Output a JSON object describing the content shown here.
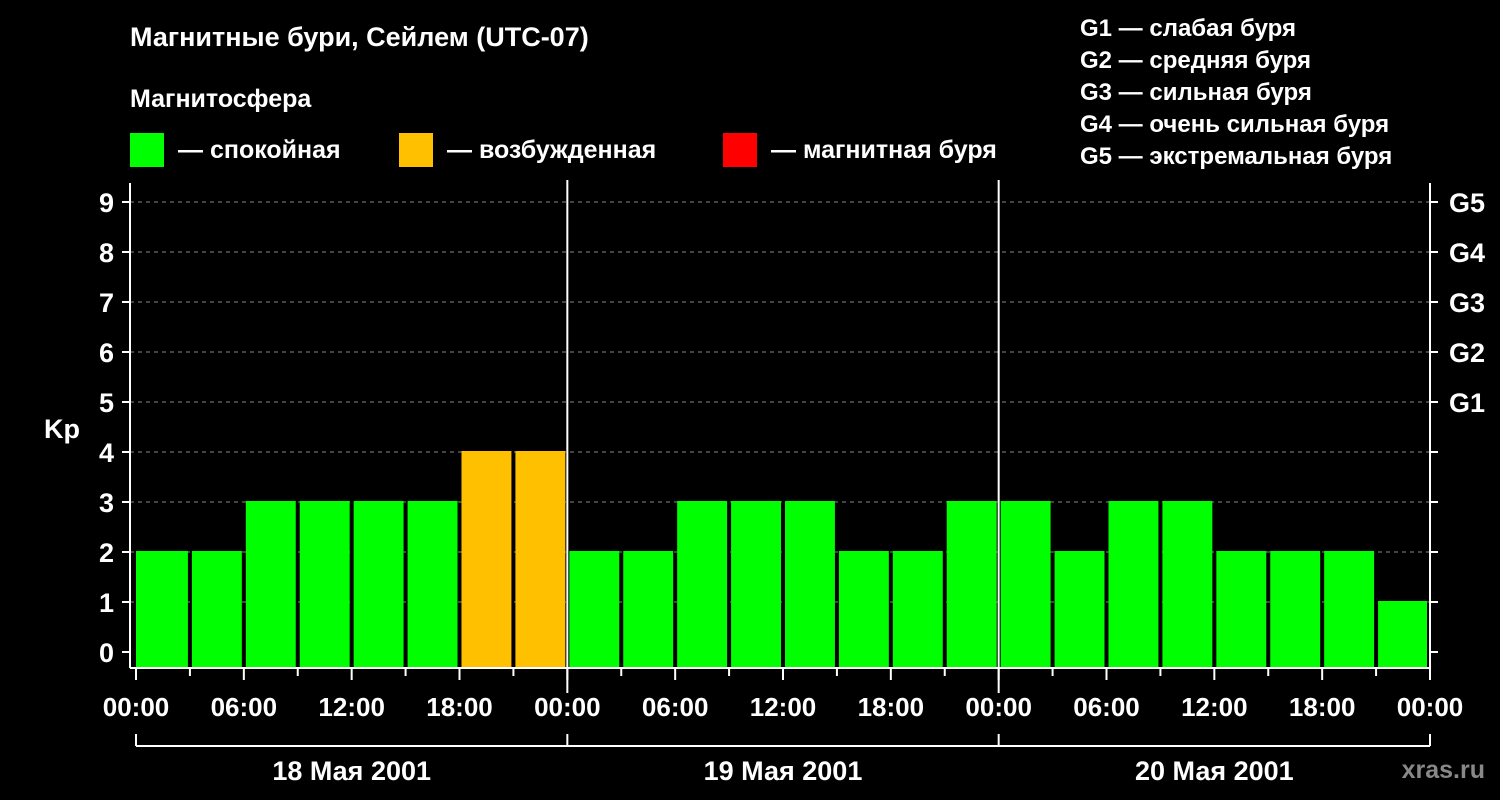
{
  "title": "Магнитные бури, Сейлем (UTC-07)",
  "subtitle": "Магнитосфера",
  "legend": [
    {
      "label": "— спокойная",
      "color": "#00ff00"
    },
    {
      "label": "— возбужденная",
      "color": "#ffc000"
    },
    {
      "label": "— магнитная буря",
      "color": "#ff0000"
    }
  ],
  "g_scale": [
    "G1 — слабая буря",
    "G2 — средняя буря",
    "G3 — сильная буря",
    "G4 — очень сильная буря",
    "G5 — экстремальная буря"
  ],
  "watermark": "xras.ru",
  "chart_data": {
    "type": "bar",
    "ylabel": "Kp",
    "ylim": [
      0,
      9
    ],
    "yticks": [
      "0",
      "1",
      "2",
      "3",
      "4",
      "5",
      "6",
      "7",
      "8",
      "9"
    ],
    "right_axis": [
      {
        "kp": 5,
        "label": "G1"
      },
      {
        "kp": 6,
        "label": "G2"
      },
      {
        "kp": 7,
        "label": "G3"
      },
      {
        "kp": 8,
        "label": "G4"
      },
      {
        "kp": 9,
        "label": "G5"
      }
    ],
    "xtick_labels": [
      "00:00",
      "06:00",
      "12:00",
      "18:00",
      "00:00",
      "06:00",
      "12:00",
      "18:00",
      "00:00",
      "06:00",
      "12:00",
      "18:00",
      "00:00"
    ],
    "days": [
      "18 Мая 2001",
      "19 Мая 2001",
      "20 Мая 2001"
    ],
    "grid": "horizontal dashed",
    "x_hours": [
      0,
      3,
      6,
      9,
      12,
      15,
      18,
      21,
      24,
      27,
      30,
      33,
      36,
      39,
      42,
      45,
      48,
      51,
      54,
      57,
      60,
      63,
      66,
      69
    ],
    "values": [
      2,
      2,
      3,
      3,
      3,
      3,
      4,
      4,
      2,
      2,
      3,
      3,
      3,
      2,
      2,
      3,
      3,
      2,
      3,
      3,
      2,
      2,
      2,
      1
    ],
    "colors": {
      "quiet": "#00ff00",
      "active": "#ffc000",
      "storm": "#ff0000"
    }
  }
}
